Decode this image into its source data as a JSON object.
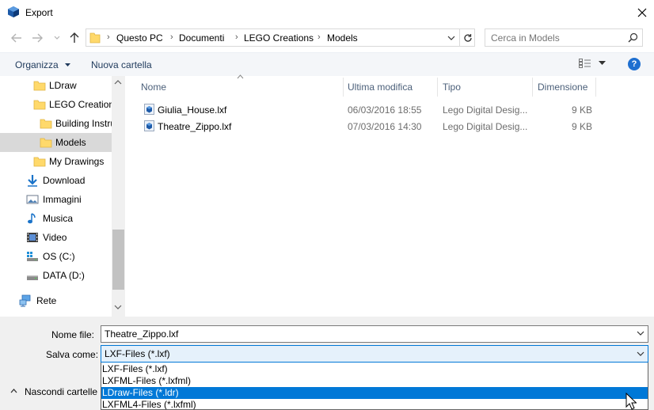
{
  "window": {
    "title": "Export",
    "close_icon": "close-icon"
  },
  "nav": {
    "breadcrumb": [
      "Questo PC",
      "Documenti",
      "LEGO Creations",
      "Models"
    ],
    "search_placeholder": "Cerca in Models"
  },
  "toolbar": {
    "organize_label": "Organizza",
    "new_folder_label": "Nuova cartella",
    "help_label": "?"
  },
  "sidebar": {
    "items": [
      {
        "label": "LDraw",
        "icon": "folder-icon"
      },
      {
        "label": "LEGO Creations",
        "icon": "folder-icon"
      },
      {
        "label": "Building Instructions",
        "icon": "folder-icon"
      },
      {
        "label": "Models",
        "icon": "folder-icon",
        "selected": true
      },
      {
        "label": "My Drawings",
        "icon": "folder-icon"
      },
      {
        "label": "Download",
        "icon": "download-icon"
      },
      {
        "label": "Immagini",
        "icon": "pictures-icon"
      },
      {
        "label": "Musica",
        "icon": "music-icon"
      },
      {
        "label": "Video",
        "icon": "video-icon"
      },
      {
        "label": "OS (C:)",
        "icon": "drive-os-icon"
      },
      {
        "label": "DATA (D:)",
        "icon": "drive-icon"
      },
      {
        "label": "Rete",
        "icon": "network-icon"
      }
    ]
  },
  "filelist": {
    "columns": [
      "Nome",
      "Ultima modifica",
      "Tipo",
      "Dimensione"
    ],
    "rows": [
      {
        "name": "Giulia_House.lxf",
        "modified": "06/03/2016 18:55",
        "type": "Lego Digital Desig...",
        "size": "9 KB"
      },
      {
        "name": "Theatre_Zippo.lxf",
        "modified": "07/03/2016 14:30",
        "type": "Lego Digital Desig...",
        "size": "9 KB"
      }
    ]
  },
  "form": {
    "filename_label": "Nome file:",
    "filename_value": "Theatre_Zippo.lxf",
    "savetype_label": "Salva come:",
    "savetype_value": "LXF-Files (*.lxf)",
    "savetype_options": [
      "LXF-Files (*.lxf)",
      "LXFML-Files (*.lxfml)",
      "LDraw-Files (*.ldr)",
      "LXFML4-Files (*.lxfml)"
    ],
    "highlighted_option": 2,
    "hide_folders_label": "Nascondi cartelle"
  },
  "colors": {
    "accent": "#0078d7",
    "selected_bg": "#d9d9d9",
    "folder": "#ffd96b",
    "link_text": "#1e395b"
  }
}
